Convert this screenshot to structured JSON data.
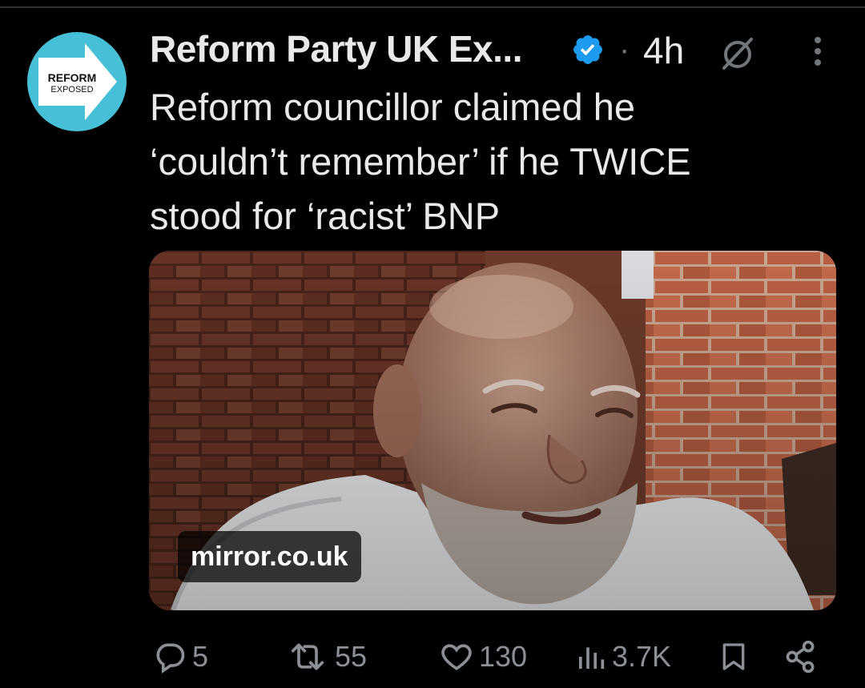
{
  "post": {
    "author_name": "Reform Party UK Ex...",
    "separator": "·",
    "time": "4h",
    "text": "Reform councillor claimed he\n‘couldn’t remember’ if he TWICE\nstood for ‘racist’ BNP",
    "avatar": {
      "line1": "REFORM",
      "line2": "EXPOSED",
      "colors": {
        "ring": "#47bfd6",
        "arrow": "#ffffff",
        "text": "#111111"
      }
    },
    "media": {
      "domain": "mirror.co.uk"
    }
  },
  "actions": {
    "replies": {
      "icon": "reply-icon",
      "count": "5"
    },
    "reposts": {
      "icon": "repost-icon",
      "count": "55"
    },
    "likes": {
      "icon": "heart-icon",
      "count": "130"
    },
    "views": {
      "icon": "views-icon",
      "count": "3.7K"
    },
    "bookmark": {
      "icon": "bookmark-icon"
    },
    "share": {
      "icon": "share-icon"
    }
  },
  "colors": {
    "background": "#000000",
    "text": "#e7e9ea",
    "muted": "#71767b",
    "verified": "#1d9bf0"
  }
}
